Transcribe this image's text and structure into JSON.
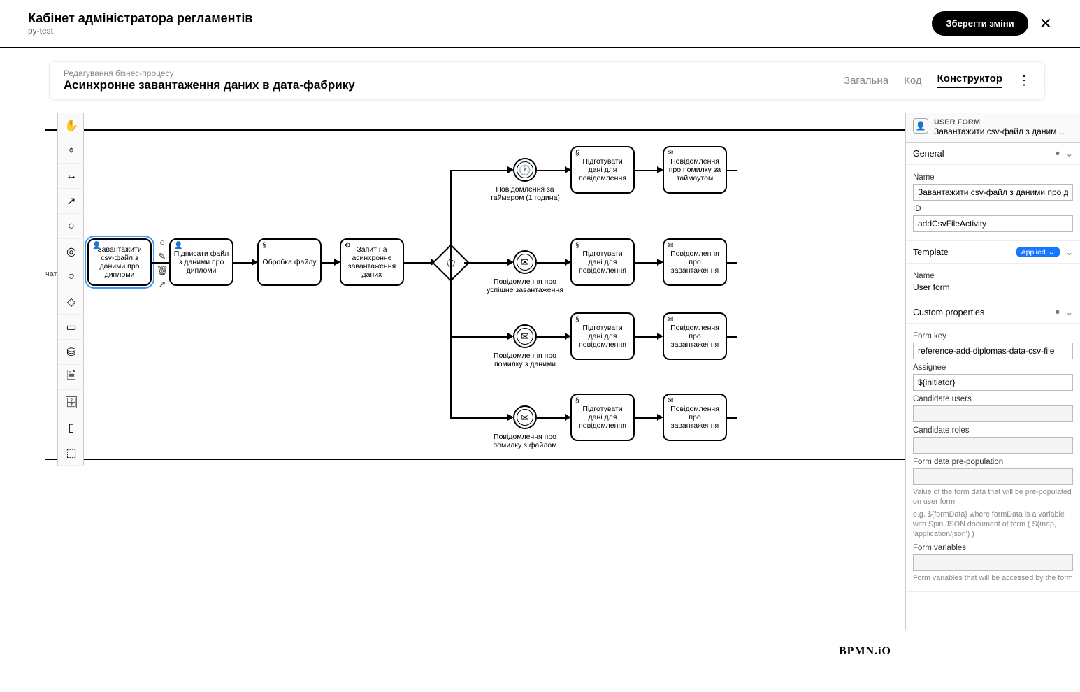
{
  "header": {
    "title": "Кабінет адміністратора регламентів",
    "subtitle": "py-test",
    "save": "Зберегти зміни"
  },
  "subheader": {
    "breadcrumb": "Редагування бізнес-процесу",
    "title": "Асинхронне завантаження даних в дата-фабрику",
    "tabs": {
      "general": "Загальна",
      "code": "Код",
      "constructor": "Конструктор"
    }
  },
  "pool_label": "чато",
  "tasks": {
    "t1": "Завантажити csv-файл з даними про дипломи",
    "t2": "Підписати файл з даними про дипломи",
    "t3": "Обробка файлу",
    "t4": "Запит на асинхронне завантаження даних",
    "r1a": "Підготувати дані для повідомлення",
    "r1b": "Повідомлення про помилку за таймаутом",
    "r2a": "Підготувати дані для повідомлення",
    "r2b": "Повідомлення про завантаження",
    "r3a": "Підготувати дані для повідомлення",
    "r3b": "Повідомлення про завантаження",
    "r4a": "Підготувати дані для повідомлення",
    "r4b": "Повідомлення про завантаження"
  },
  "events": {
    "e1": "Повідомлення за таймером (1 година)",
    "e2": "Повідомлення про успішне завантаження",
    "e3": "Повідомлення про помилку з даними",
    "e4": "Повідомлення про помилку з файлом"
  },
  "props": {
    "header_type": "USER FORM",
    "header_name": "Завантажити csv-файл з даними пр...",
    "section_general": "General",
    "name_label": "Name",
    "name_value": "Завантажити csv-файл з даними про ди",
    "id_label": "ID",
    "id_value": "addCsvFileActivity",
    "section_template": "Template",
    "template_badge": "Applied",
    "template_name_label": "Name",
    "template_name_value": "User form",
    "section_custom": "Custom properties",
    "formkey_label": "Form key",
    "formkey_value": "reference-add-diplomas-data-csv-file",
    "assignee_label": "Assignee",
    "assignee_value": "${initiator}",
    "cand_users_label": "Candidate users",
    "cand_roles_label": "Candidate roles",
    "prepop_label": "Form data pre-population",
    "prepop_hint1": "Value of the form data that will be pre-populated on user form",
    "prepop_hint2": "e.g. ${formData} where formData is a variable with Spin JSON document of form ( S(map, 'application/json') )",
    "formvars_label": "Form variables",
    "formvars_hint": "Form variables that will be accessed by the form"
  },
  "brand": "BPMN.iO"
}
